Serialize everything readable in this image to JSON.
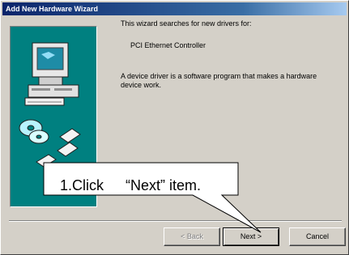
{
  "window": {
    "title": "Add New Hardware Wizard"
  },
  "content": {
    "intro": "This wizard searches for new drivers for:",
    "device_name": "PCI Ethernet Controller",
    "description": "A device driver is a software program that makes a hardware device work."
  },
  "buttons": {
    "back": "< Back",
    "next": "Next >",
    "cancel": "Cancel"
  },
  "callout": {
    "step": "1.Click",
    "target": "“Next” item."
  },
  "icons": [
    "computer-icon",
    "cd-disc-icon"
  ],
  "colors": {
    "titlebar_start": "#0a246a",
    "titlebar_end": "#a6caf0",
    "panel_background": "#008080",
    "dialog_background": "#d4d0c8"
  }
}
